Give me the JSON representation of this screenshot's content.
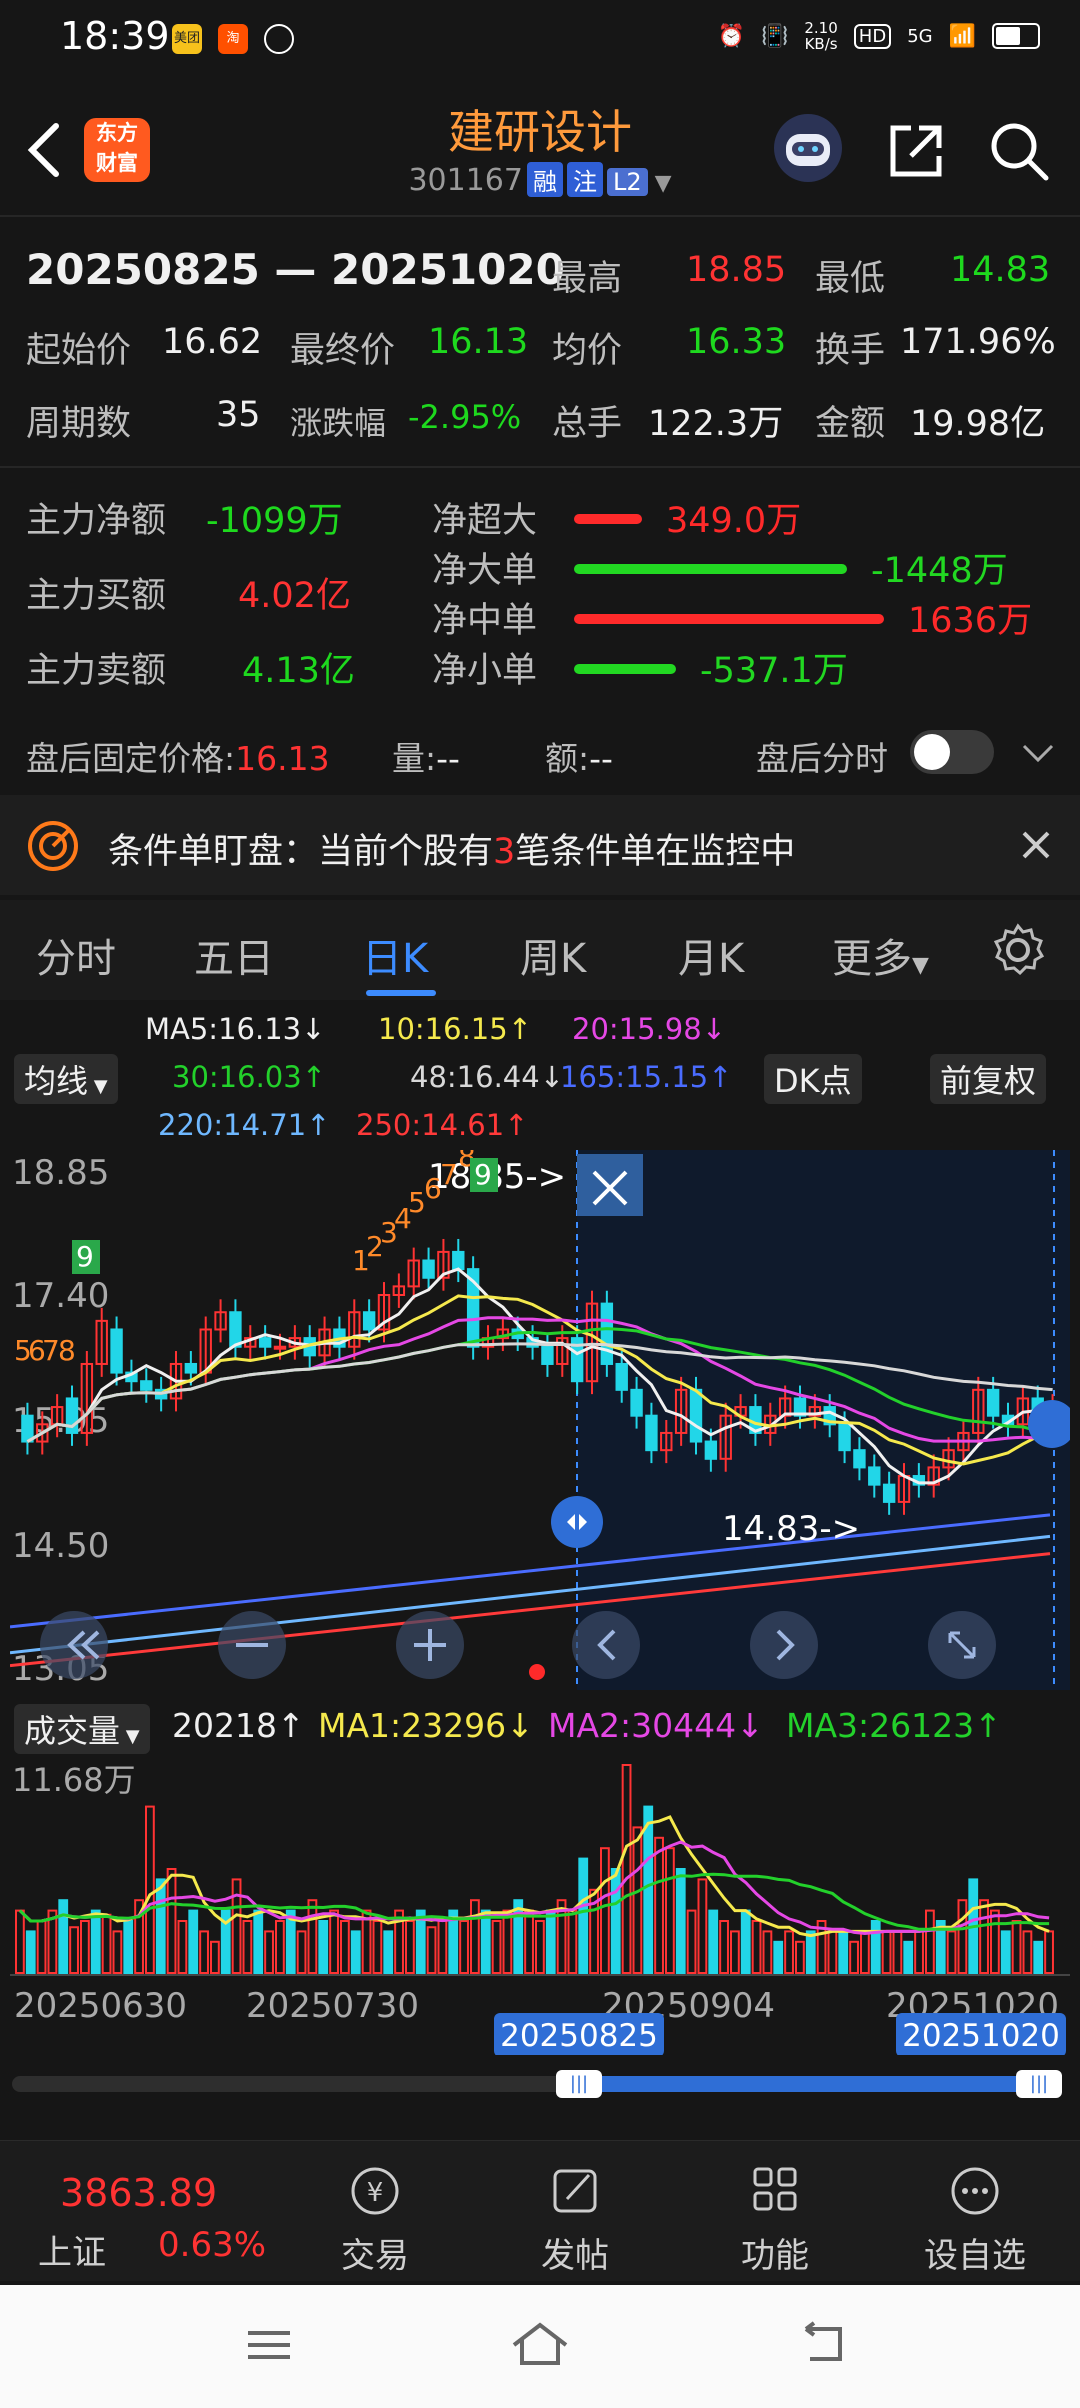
{
  "status": {
    "time": "18:39",
    "net_speed": "2.10\nKB/s",
    "net_top": "2.10",
    "net_unit": "KB/s",
    "hd": "HD",
    "fiveg": "5G",
    "apps": [
      "美团",
      "淘"
    ]
  },
  "header": {
    "logo_line1": "东方",
    "logo_line2": "财富",
    "name": "建研设计",
    "code": "301167",
    "tags": [
      "融",
      "注",
      "L2"
    ]
  },
  "summary": {
    "range": "20250825 — 20251020",
    "high_label": "最高",
    "high": "18.85",
    "low_label": "最低",
    "low": "14.83",
    "start_label": "起始价",
    "start": "16.62",
    "end_label": "最终价",
    "end": "16.13",
    "avg_label": "均价",
    "avg": "16.33",
    "turnover_label": "换手",
    "turnover": "171.96%",
    "period_label": "周期数",
    "period": "35",
    "change_label": "涨跌幅",
    "change": "-2.95%",
    "volume_label": "总手",
    "volume": "122.3万",
    "amount_label": "金额",
    "amount": "19.98亿"
  },
  "capital": {
    "net_label": "主力净额",
    "net": "-1099万",
    "buy_label": "主力买额",
    "buy": "4.02亿",
    "sell_label": "主力卖额",
    "sell": "4.13亿",
    "flows": [
      {
        "label": "净超大",
        "value": "349.0万",
        "color": "#ff2a2a",
        "frac": 0.22
      },
      {
        "label": "净大单",
        "value": "-1448万",
        "color": "#22d822",
        "frac": 0.88
      },
      {
        "label": "净中单",
        "value": "1636万",
        "color": "#ff2a2a",
        "frac": 1.0
      },
      {
        "label": "净小单",
        "value": "-537.1万",
        "color": "#22d822",
        "frac": 0.33
      }
    ]
  },
  "afterhours": {
    "fixed_label": "盘后固定价格:",
    "fixed": "16.13",
    "vol_label": "量:",
    "vol": "--",
    "amt_label": "额:",
    "amt": "--",
    "toggle_label": "盘后分时"
  },
  "notice": {
    "prefix": "条件单盯盘：当前个股有",
    "count": "3",
    "suffix": "笔条件单在监控中"
  },
  "tabs": [
    "分时",
    "五日",
    "日K",
    "周K",
    "月K",
    "更多"
  ],
  "ma": {
    "ma5": "MA5:16.13↓",
    "ma10": "10:16.15↑",
    "ma20": "20:15.98↓",
    "ma30": "30:16.03↑",
    "ma48": "48:16.44↓",
    "ma165": "165:15.15↑",
    "ma220": "220:14.71↑",
    "ma250": "250:14.61↑",
    "selector": "均线",
    "dk": "DK点",
    "fq": "前复权"
  },
  "chart_data": {
    "type": "candlestick",
    "y_ticks": [
      "18.85",
      "17.40",
      "15.95",
      "14.50",
      "13.05"
    ],
    "ylim": [
      13.05,
      18.85
    ],
    "high_marker": "18.85->",
    "low_marker": "14.83->",
    "td_labels_up": [
      "5",
      "6",
      "7",
      "8",
      "9",
      "1",
      "2",
      "3",
      "4",
      "5",
      "6",
      "7",
      "8",
      "9"
    ],
    "candles": [
      {
        "o": 16.0,
        "c": 15.7
      },
      {
        "o": 15.7,
        "c": 15.9
      },
      {
        "o": 15.9,
        "c": 16.1
      },
      {
        "o": 16.2,
        "c": 15.8
      },
      {
        "o": 15.8,
        "c": 16.6
      },
      {
        "o": 16.6,
        "c": 17.1
      },
      {
        "o": 17.0,
        "c": 16.5
      },
      {
        "o": 16.5,
        "c": 16.4
      },
      {
        "o": 16.4,
        "c": 16.3
      },
      {
        "o": 16.3,
        "c": 16.2
      },
      {
        "o": 16.2,
        "c": 16.6
      },
      {
        "o": 16.6,
        "c": 16.5
      },
      {
        "o": 16.5,
        "c": 17.0
      },
      {
        "o": 17.0,
        "c": 17.2
      },
      {
        "o": 17.2,
        "c": 16.8
      },
      {
        "o": 16.8,
        "c": 16.9
      },
      {
        "o": 16.9,
        "c": 16.8
      },
      {
        "o": 16.8,
        "c": 16.8
      },
      {
        "o": 16.8,
        "c": 16.9
      },
      {
        "o": 16.9,
        "c": 16.7
      },
      {
        "o": 16.7,
        "c": 17.0
      },
      {
        "o": 17.0,
        "c": 16.8
      },
      {
        "o": 16.8,
        "c": 17.2
      },
      {
        "o": 17.2,
        "c": 17.0
      },
      {
        "o": 17.0,
        "c": 17.4
      },
      {
        "o": 17.4,
        "c": 17.5
      },
      {
        "o": 17.5,
        "c": 17.8
      },
      {
        "o": 17.8,
        "c": 17.6
      },
      {
        "o": 17.6,
        "c": 17.9
      },
      {
        "o": 17.9,
        "c": 17.7
      },
      {
        "o": 17.7,
        "c": 16.8
      },
      {
        "o": 16.8,
        "c": 16.9
      },
      {
        "o": 16.9,
        "c": 17.0
      },
      {
        "o": 17.0,
        "c": 16.9
      },
      {
        "o": 16.9,
        "c": 16.8
      },
      {
        "o": 16.8,
        "c": 16.6
      },
      {
        "o": 16.6,
        "c": 16.9
      },
      {
        "o": 16.9,
        "c": 16.4
      },
      {
        "o": 16.4,
        "c": 17.3
      },
      {
        "o": 17.3,
        "c": 16.6
      },
      {
        "o": 16.6,
        "c": 16.3
      },
      {
        "o": 16.3,
        "c": 16.0
      },
      {
        "o": 16.0,
        "c": 15.6
      },
      {
        "o": 15.6,
        "c": 15.8
      },
      {
        "o": 15.8,
        "c": 16.3
      },
      {
        "o": 16.3,
        "c": 15.7
      },
      {
        "o": 15.7,
        "c": 15.5
      },
      {
        "o": 15.5,
        "c": 16.0
      },
      {
        "o": 16.0,
        "c": 16.1
      },
      {
        "o": 16.1,
        "c": 15.8
      },
      {
        "o": 15.8,
        "c": 16.0
      },
      {
        "o": 16.0,
        "c": 16.2
      },
      {
        "o": 16.2,
        "c": 16.0
      },
      {
        "o": 16.0,
        "c": 16.1
      },
      {
        "o": 16.1,
        "c": 15.9
      },
      {
        "o": 15.9,
        "c": 15.6
      },
      {
        "o": 15.6,
        "c": 15.4
      },
      {
        "o": 15.4,
        "c": 15.2
      },
      {
        "o": 15.2,
        "c": 15.0
      },
      {
        "o": 15.0,
        "c": 15.3
      },
      {
        "o": 15.3,
        "c": 15.2
      },
      {
        "o": 15.2,
        "c": 15.4
      },
      {
        "o": 15.4,
        "c": 15.6
      },
      {
        "o": 15.6,
        "c": 15.8
      },
      {
        "o": 15.8,
        "c": 16.3
      },
      {
        "o": 16.3,
        "c": 16.0
      },
      {
        "o": 16.0,
        "c": 15.9
      },
      {
        "o": 15.9,
        "c": 16.2
      },
      {
        "o": 16.2,
        "c": 15.9
      },
      {
        "o": 15.9,
        "c": 16.1
      }
    ],
    "volume": {
      "selector": "成交量",
      "value": "20218↑",
      "ma1": "MA1:23296↓",
      "ma2": "MA2:30444↓",
      "ma3": "MA3:26123↑",
      "max_label": "11.68万",
      "bars": [
        0.3,
        0.2,
        0.25,
        0.3,
        0.35,
        0.22,
        0.25,
        0.3,
        0.28,
        0.2,
        0.25,
        0.35,
        0.8,
        0.45,
        0.5,
        0.25,
        0.3,
        0.2,
        0.15,
        0.3,
        0.45,
        0.25,
        0.3,
        0.2,
        0.25,
        0.3,
        0.2,
        0.35,
        0.25,
        0.3,
        0.25,
        0.2,
        0.3,
        0.25,
        0.2,
        0.3,
        0.25,
        0.3,
        0.22,
        0.25,
        0.3,
        0.25,
        0.35,
        0.3,
        0.25,
        0.3,
        0.35,
        0.3,
        0.25,
        0.3,
        0.35,
        0.3,
        0.55,
        0.4,
        0.6,
        0.5,
        1.0,
        0.7,
        0.8,
        0.65,
        0.6,
        0.5,
        0.3,
        0.45,
        0.3,
        0.25,
        0.2,
        0.3,
        0.25,
        0.2,
        0.15,
        0.2,
        0.15,
        0.2,
        0.25,
        0.2,
        0.2,
        0.15,
        0.2,
        0.25,
        0.2,
        0.2,
        0.15,
        0.2,
        0.3,
        0.25,
        0.2,
        0.35,
        0.45,
        0.35,
        0.3,
        0.2,
        0.25,
        0.2,
        0.15,
        0.2
      ],
      "dates": [
        "20250630",
        "20250730",
        "20250904",
        "20251020"
      ]
    },
    "range_start": "20250825",
    "range_end": "20251020"
  },
  "bottom": {
    "index_value": "3863.89",
    "index_name": "上证",
    "index_change": "0.63%",
    "items": [
      "交易",
      "发帖",
      "功能",
      "设自选"
    ]
  }
}
